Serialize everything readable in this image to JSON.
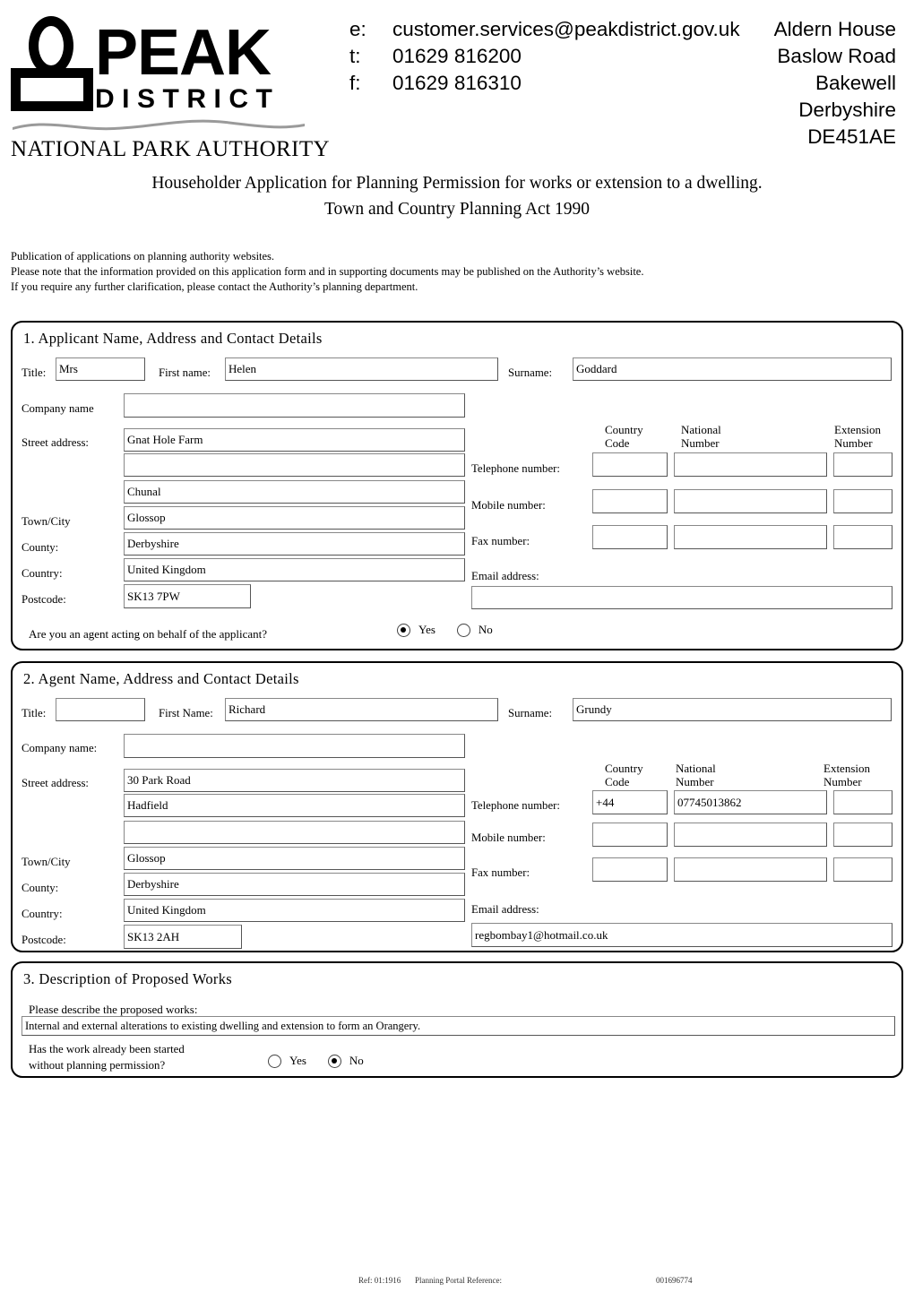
{
  "header": {
    "logo": {
      "word_peak": "PEAK",
      "word_district": "DISTRICT",
      "word_authority": "NATIONAL PARK  AUTHORITY"
    },
    "contact": [
      {
        "key": "e:",
        "value": "customer.services@peakdistrict.gov.uk"
      },
      {
        "key": "t:",
        "value": "01629 816200"
      },
      {
        "key": "f:",
        "value": "01629 816310"
      }
    ],
    "address": [
      "Aldern House",
      "Baslow Road",
      "Bakewell",
      "Derbyshire",
      "DE451AE"
    ]
  },
  "title": {
    "line1": "Householder Application for Planning Permission for works or extension to a dwelling.",
    "line2": "Town and Country Planning Act 1990"
  },
  "notice": {
    "line1": "Publication of applications on planning authority websites.",
    "line2": "Please note that the information provided on this application form and in supporting documents may be published on the Authority’s website.",
    "line3": "If you require any further clarification, please contact the Authority’s planning department."
  },
  "section1": {
    "heading": "1.  Applicant Name, Address and Contact Details",
    "labels": {
      "title": "Title:",
      "first_name": "First name:",
      "surname": "Surname:",
      "company": "Company name",
      "street": "Street address:",
      "town": "Town/City",
      "county": "County:",
      "country": "Country:",
      "postcode": "Postcode:",
      "country_code": "Country\nCode",
      "country_code_l1": "Country",
      "country_code_l2": "Code",
      "national_number_l1": "National",
      "national_number_l2": "Number",
      "extension_number_l1": "Extension",
      "extension_number_l2": "Number",
      "telephone": "Telephone number:",
      "mobile": "Mobile number:",
      "fax": "Fax number:",
      "email": "Email address:",
      "agent_question": "Are you an agent acting on behalf of the applicant?"
    },
    "values": {
      "title": "Mrs",
      "first_name": "Helen",
      "surname": "Goddard",
      "company": "",
      "street1": "Gnat Hole Farm",
      "street2": "",
      "street3": "Chunal",
      "town": "Glossop",
      "county": "Derbyshire",
      "country": "United Kingdom",
      "postcode": "SK13 7PW",
      "tel_cc": "",
      "tel_nat": "",
      "tel_ext": "",
      "mob_cc": "",
      "mob_nat": "",
      "mob_ext": "",
      "fax_cc": "",
      "fax_nat": "",
      "fax_ext": "",
      "email": ""
    },
    "agent_radio": {
      "yes_label": "Yes",
      "no_label": "No",
      "selected": "Yes"
    }
  },
  "section2": {
    "heading": "2.  Agent Name, Address and Contact Details",
    "labels": {
      "title": "Title:",
      "first_name": "First Name:",
      "surname": "Surname:",
      "company": "Company name:",
      "street": "Street address:",
      "town": "Town/City",
      "county": "County:",
      "country": "Country:",
      "postcode": "Postcode:",
      "country_code_l1": "Country",
      "country_code_l2": "Code",
      "national_number_l1": "National",
      "national_number_l2": "Number",
      "extension_number_l1": "Extension",
      "extension_number_l2": "Number",
      "telephone": "Telephone number:",
      "mobile": "Mobile number:",
      "fax": "Fax number:",
      "email": "Email address:"
    },
    "values": {
      "title": "",
      "first_name": "Richard",
      "surname": "Grundy",
      "company": "",
      "street1": "30 Park Road",
      "street2": "Hadfield",
      "street3": "",
      "town": "Glossop",
      "county": "Derbyshire",
      "country": "United Kingdom",
      "postcode": "SK13 2AH",
      "tel_cc": "+44",
      "tel_nat": "07745013862",
      "tel_ext": "",
      "mob_cc": "",
      "mob_nat": "",
      "mob_ext": "",
      "fax_cc": "",
      "fax_nat": "",
      "fax_ext": "",
      "email": "regbombay1@hotmail.co.uk"
    }
  },
  "section3": {
    "heading": "3.  Description of Proposed Works",
    "labels": {
      "describe": "Please describe the proposed works:",
      "started_l1": "Has the work already been started",
      "started_l2": "without planning permission?"
    },
    "values": {
      "description": "Internal and external alterations to existing dwelling and extension to form an Orangery."
    },
    "started_radio": {
      "yes_label": "Yes",
      "no_label": "No",
      "selected": "No"
    }
  },
  "footer": {
    "ref": "Ref: 01:1916",
    "portal_label": "Planning Portal Reference:",
    "portal_value": "001696774"
  }
}
